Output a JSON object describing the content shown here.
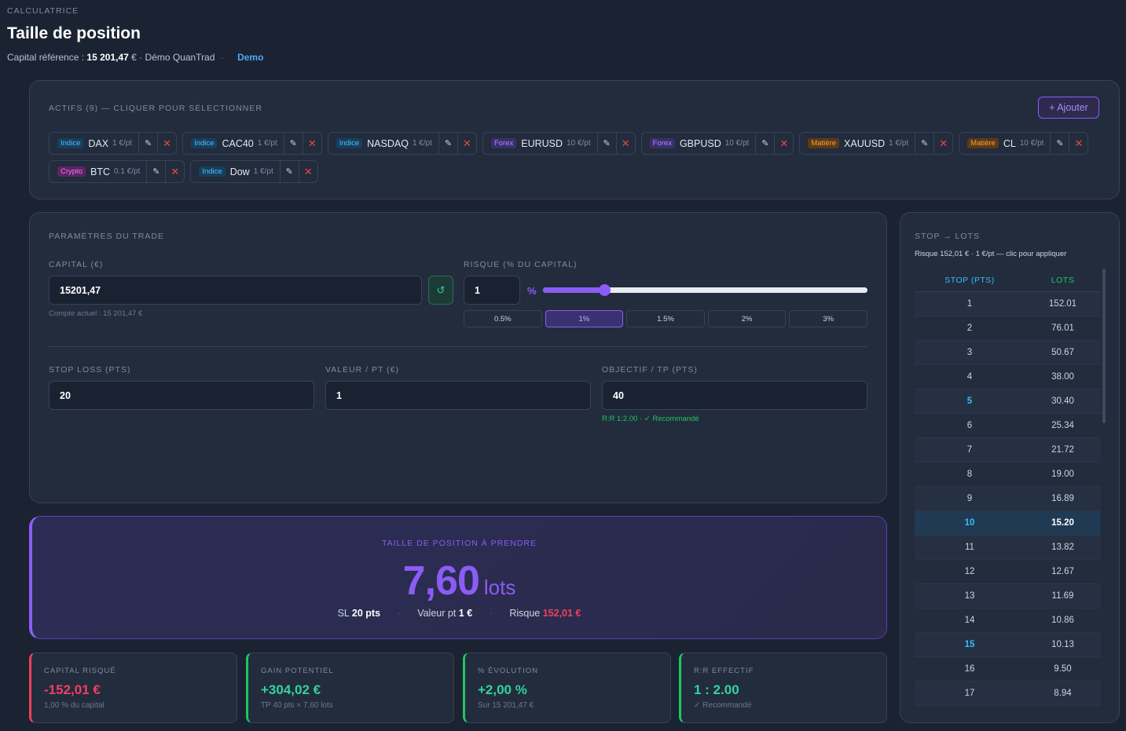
{
  "header": {
    "eyebrow": "CALCULATRICE",
    "title": "Taille de position",
    "capital_label": "Capital référence :",
    "capital_value": "15 201,47",
    "capital_suffix": "€ · Démo QuanTrad",
    "sep": "·",
    "account_type": "Demo"
  },
  "assets": {
    "title": "ACTIFS (9) — CLIQUER POUR SÉLECTIONNER",
    "add_label": "+ Ajouter",
    "edit_icon": "✎",
    "delete_icon": "✕",
    "items": [
      {
        "tag": "Indice",
        "kind": "indice",
        "name": "DAX",
        "value": "1 €/pt"
      },
      {
        "tag": "Indice",
        "kind": "indice",
        "name": "CAC40",
        "value": "1 €/pt"
      },
      {
        "tag": "Indice",
        "kind": "indice",
        "name": "NASDAQ",
        "value": "1 €/pt"
      },
      {
        "tag": "Forex",
        "kind": "forex",
        "name": "EURUSD",
        "value": "10 €/pt"
      },
      {
        "tag": "Forex",
        "kind": "forex",
        "name": "GBPUSD",
        "value": "10 €/pt"
      },
      {
        "tag": "Matière",
        "kind": "matiere",
        "name": "XAUUSD",
        "value": "1 €/pt"
      },
      {
        "tag": "Matière",
        "kind": "matiere",
        "name": "CL",
        "value": "10 €/pt"
      },
      {
        "tag": "Crypto",
        "kind": "crypto",
        "name": "BTC",
        "value": "0.1 €/pt"
      },
      {
        "tag": "Indice",
        "kind": "indice",
        "name": "Dow",
        "value": "1 €/pt"
      }
    ]
  },
  "params": {
    "title": "PARAMÈTRES DU TRADE",
    "capital_label": "CAPITAL (€)",
    "capital_value": "15201,47",
    "capital_hint": "Compte actuel : 15 201,47 €",
    "refresh_icon": "↺",
    "risk_label": "RISQUE (% DU CAPITAL)",
    "risk_value": "1",
    "risk_unit": "%",
    "risk_slider_fraction": 0.19,
    "presets": [
      "0.5%",
      "1%",
      "1.5%",
      "2%",
      "3%"
    ],
    "active_preset": 1,
    "stop_label": "STOP LOSS (PTS)",
    "stop_value": "20",
    "pt_label": "VALEUR / PT (€)",
    "pt_value": "1",
    "tp_label": "OBJECTIF / TP (PTS)",
    "tp_value": "40",
    "rr_note": "R:R 1:2.00 · ✓ Recommandé"
  },
  "result": {
    "label": "TAILLE DE POSITION À PRENDRE",
    "value": "7,60",
    "unit": "lots",
    "sl_label": "SL",
    "sl_value": "20 pts",
    "pt_label": "Valeur pt",
    "pt_value": "1 €",
    "risk_label": "Risque",
    "risk_value": "152,01 €",
    "dot": "·"
  },
  "stats": [
    {
      "label": "CAPITAL RISQUÉ",
      "value": "-152,01 €",
      "sub": "1,00 % du capital",
      "tone": "red"
    },
    {
      "label": "GAIN POTENTIEL",
      "value": "+304,02 €",
      "sub": "TP 40 pts × 7,60 lots",
      "tone": "green"
    },
    {
      "label": "% ÉVOLUTION",
      "value": "+2,00 %",
      "sub": "Sur 15 201,47 €",
      "tone": "green"
    },
    {
      "label": "R:R EFFECTIF",
      "value": "1 : 2.00",
      "sub": "✓ Recommandé",
      "tone": "green"
    }
  ],
  "stop_table": {
    "title": "STOP → LOTS",
    "subtitle": "Risque 152,01 € · 1 €/pt — clic pour appliquer",
    "col_stop": "STOP (PTS)",
    "col_lots": "LOTS",
    "rows": [
      {
        "stop": "1",
        "lots": "152.01"
      },
      {
        "stop": "2",
        "lots": "76.01"
      },
      {
        "stop": "3",
        "lots": "50.67"
      },
      {
        "stop": "4",
        "lots": "38.00"
      },
      {
        "stop": "5",
        "lots": "30.40",
        "mark": true
      },
      {
        "stop": "6",
        "lots": "25.34"
      },
      {
        "stop": "7",
        "lots": "21.72"
      },
      {
        "stop": "8",
        "lots": "19.00"
      },
      {
        "stop": "9",
        "lots": "16.89"
      },
      {
        "stop": "10",
        "lots": "15.20",
        "highlight": true
      },
      {
        "stop": "11",
        "lots": "13.82"
      },
      {
        "stop": "12",
        "lots": "12.67"
      },
      {
        "stop": "13",
        "lots": "11.69"
      },
      {
        "stop": "14",
        "lots": "10.86"
      },
      {
        "stop": "15",
        "lots": "10.13",
        "mark": true
      },
      {
        "stop": "16",
        "lots": "9.50"
      },
      {
        "stop": "17",
        "lots": "8.94"
      }
    ]
  }
}
